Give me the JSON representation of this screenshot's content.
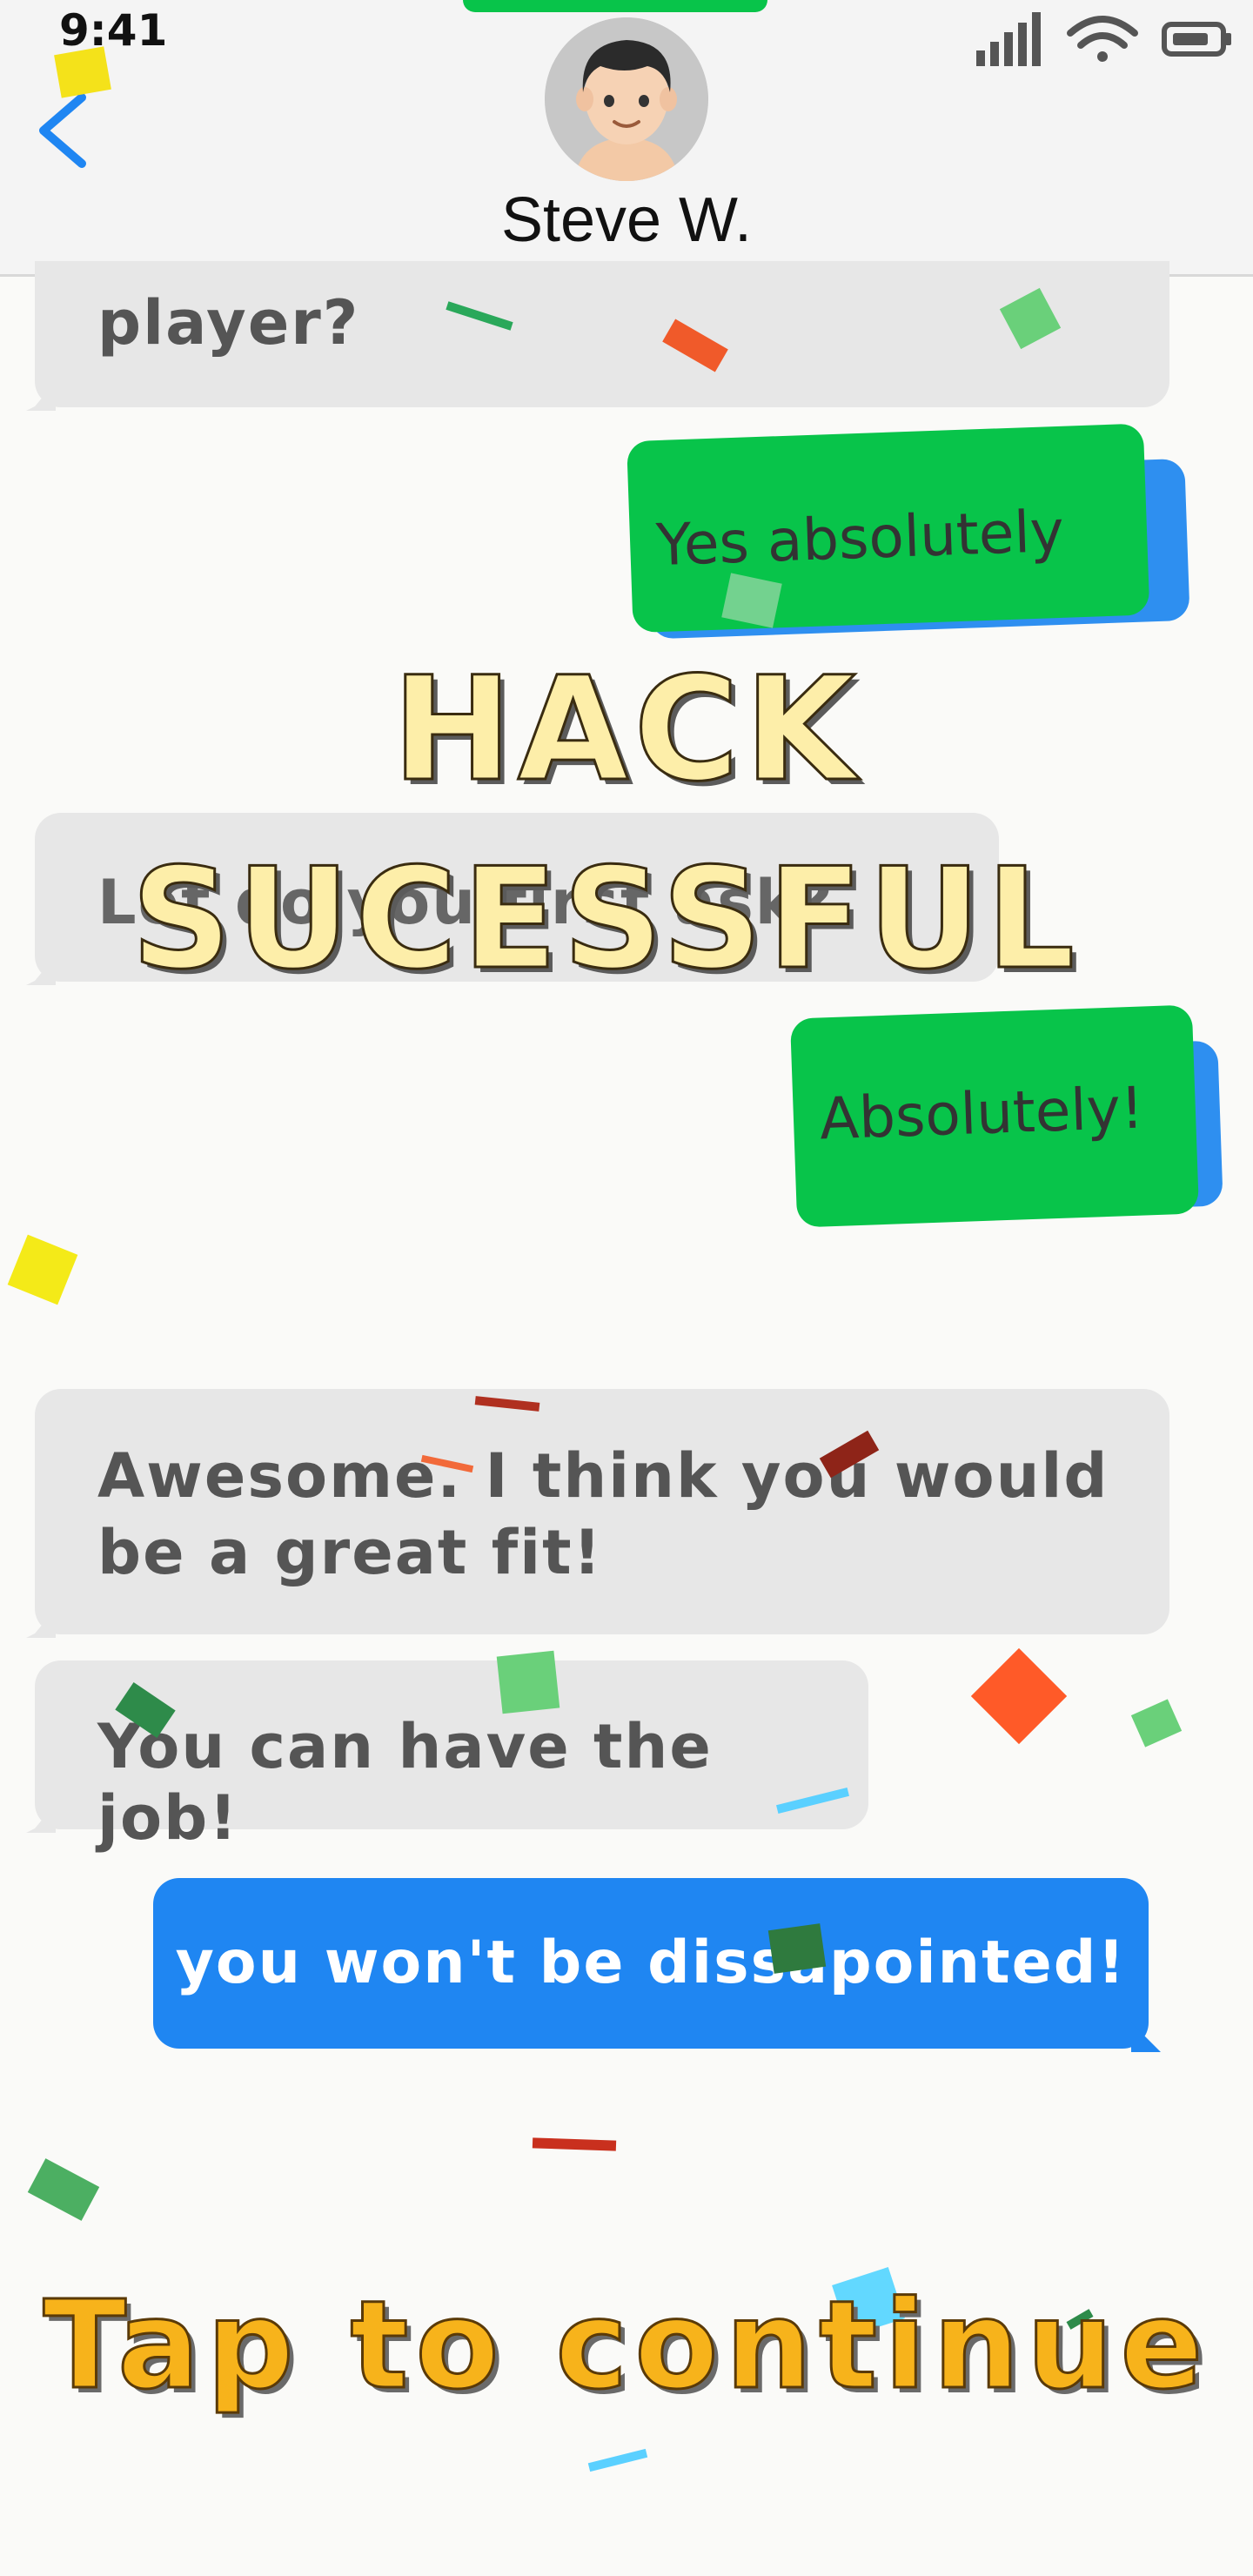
{
  "status_bar": {
    "time": "9:41"
  },
  "header": {
    "contact_name": "Steve W."
  },
  "messages": [
    {
      "sender": "contact",
      "text": "player?"
    },
    {
      "sender": "me",
      "text": "Yes absolutely"
    },
    {
      "sender": "contact",
      "text": "Let do you first ask?"
    },
    {
      "sender": "me",
      "text": "Absolutely!"
    },
    {
      "sender": "contact",
      "text": "Awesome. I think you would be a great fit!"
    },
    {
      "sender": "contact",
      "text": "You can have the job!"
    },
    {
      "sender": "me_typed",
      "text": "you won't be dissapointed!"
    }
  ],
  "overlay": {
    "line1": "HACK",
    "line2": "SUCESSFUL",
    "continue": "Tap to continue"
  },
  "colors": {
    "accent_blue": "#1f86f2",
    "accent_green": "#08c44a",
    "gold": "#f7b31b",
    "gray_bubble": "#e7e7e7"
  }
}
